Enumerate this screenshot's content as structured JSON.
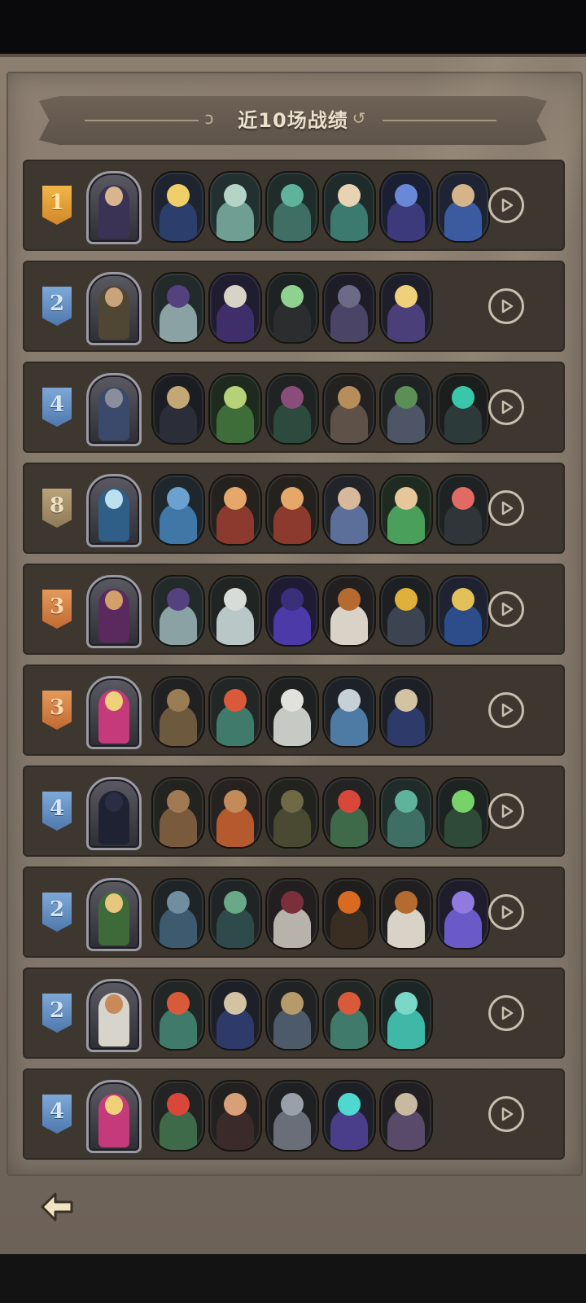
{
  "header": {
    "title": "近10场战绩"
  },
  "matches": [
    {
      "rank": "1",
      "rank_style": "gold",
      "leader": {
        "icon": "leader-portrait-detective",
        "color": "#3b3355",
        "skin": "#d9b58e"
      },
      "heroes": [
        {
          "icon": "hero-portrait-star-boy",
          "bg": "#1e2531",
          "body": "#2c3e6b",
          "face": "#f0cf6a"
        },
        {
          "icon": "hero-portrait-goat",
          "bg": "#223030",
          "body": "#6f9e93",
          "face": "#b6d3c8"
        },
        {
          "icon": "hero-portrait-frog",
          "bg": "#1f2c2a",
          "body": "#3e6e64",
          "face": "#5fb39b"
        },
        {
          "icon": "hero-portrait-bard",
          "bg": "#1f2a2a",
          "body": "#3d7a6e",
          "face": "#e7d2b4"
        },
        {
          "icon": "hero-portrait-sorceress",
          "bg": "#1b1f33",
          "body": "#3c3a7a",
          "face": "#6a88d8"
        },
        {
          "icon": "hero-portrait-king",
          "bg": "#1e2433",
          "body": "#3c5aa0",
          "face": "#d6b48a"
        }
      ]
    },
    {
      "rank": "2",
      "rank_style": "blue",
      "leader": {
        "icon": "leader-portrait-gentleman",
        "color": "#4f4633",
        "skin": "#c8a37c"
      },
      "heroes": [
        {
          "icon": "hero-portrait-tophat",
          "bg": "#232a2a",
          "body": "#8aa2a4",
          "face": "#53427d"
        },
        {
          "icon": "hero-portrait-skeleton",
          "bg": "#211d30",
          "body": "#3e2f6a",
          "face": "#d7d3c6"
        },
        {
          "icon": "hero-portrait-reaper",
          "bg": "#1d2322",
          "body": "#2b2d2f",
          "face": "#8fd18f"
        },
        {
          "icon": "hero-portrait-octopus",
          "bg": "#1e1d27",
          "body": "#4a4466",
          "face": "#6d6a88"
        },
        {
          "icon": "hero-portrait-blonde-girl",
          "bg": "#1e1f2a",
          "body": "#4b3f7a",
          "face": "#f0d07a"
        }
      ]
    },
    {
      "rank": "4",
      "rank_style": "blue",
      "leader": {
        "icon": "leader-portrait-bear",
        "color": "#3b4a6a",
        "skin": "#8b8e9a"
      },
      "heroes": [
        {
          "icon": "hero-portrait-ghoul",
          "bg": "#1b1d22",
          "body": "#2b2e38",
          "face": "#c3a876"
        },
        {
          "icon": "hero-portrait-sprout",
          "bg": "#1f2a1f",
          "body": "#3f6d39",
          "face": "#b5d278"
        },
        {
          "icon": "hero-portrait-witch",
          "bg": "#1f2322",
          "body": "#2d4a3e",
          "face": "#8a4d7a"
        },
        {
          "icon": "hero-portrait-cat",
          "bg": "#232221",
          "body": "#5e5248",
          "face": "#b78d5b"
        },
        {
          "icon": "hero-portrait-goblin-knight",
          "bg": "#1f2324",
          "body": "#4d5566",
          "face": "#5c8f55"
        },
        {
          "icon": "hero-portrait-demon-mask",
          "bg": "#1c1e1e",
          "body": "#2c3a39",
          "face": "#38c7a8"
        }
      ]
    },
    {
      "rank": "8",
      "rank_style": "tan",
      "leader": {
        "icon": "leader-portrait-ice-queen",
        "color": "#2f5e86",
        "skin": "#bde0ef"
      },
      "heroes": [
        {
          "icon": "hero-portrait-blue-dragon",
          "bg": "#1f262c",
          "body": "#3f77a6",
          "face": "#6ba1cf"
        },
        {
          "icon": "hero-portrait-dwarf",
          "bg": "#25221e",
          "body": "#8c3a2e",
          "face": "#e6a86a"
        },
        {
          "icon": "hero-portrait-dwarf-2",
          "bg": "#25221e",
          "body": "#8c3a2e",
          "face": "#e6a86a"
        },
        {
          "icon": "hero-portrait-swordsman",
          "bg": "#22242a",
          "body": "#5b6f9a",
          "face": "#d8b89a"
        },
        {
          "icon": "hero-portrait-fairy",
          "bg": "#1f2b21",
          "body": "#4aa05a",
          "face": "#e5c79a"
        },
        {
          "icon": "hero-portrait-fish-robot",
          "bg": "#1e2222",
          "body": "#2f3538",
          "face": "#e26a64"
        }
      ]
    },
    {
      "rank": "3",
      "rank_style": "orange",
      "leader": {
        "icon": "leader-portrait-wizard",
        "color": "#5a2a5e",
        "skin": "#d4a06a"
      },
      "heroes": [
        {
          "icon": "hero-portrait-tophat",
          "bg": "#232a2a",
          "body": "#8aa2a4",
          "face": "#53427d"
        },
        {
          "icon": "hero-portrait-bird",
          "bg": "#202524",
          "body": "#b9c7c6",
          "face": "#d8dcd6"
        },
        {
          "icon": "hero-portrait-purple-beast",
          "bg": "#1f1b33",
          "body": "#4b3aa8",
          "face": "#3a2f7a"
        },
        {
          "icon": "hero-portrait-pumpkin",
          "bg": "#211f1f",
          "body": "#d8d3c6",
          "face": "#b56a2f"
        },
        {
          "icon": "hero-portrait-tv-robot",
          "bg": "#1d2022",
          "body": "#3c4452",
          "face": "#e0b03c"
        },
        {
          "icon": "hero-portrait-golden-knight",
          "bg": "#1f2331",
          "body": "#2d4d8a",
          "face": "#e2c05a"
        }
      ]
    },
    {
      "rank": "3",
      "rank_style": "orange",
      "leader": {
        "icon": "leader-portrait-blonde-lady",
        "color": "#c43a7a",
        "skin": "#f1d07a"
      },
      "heroes": [
        {
          "icon": "hero-portrait-boar",
          "bg": "#212121",
          "body": "#6d5a3e",
          "face": "#9a7d55"
        },
        {
          "icon": "hero-portrait-redhead",
          "bg": "#222624",
          "body": "#3f7a6a",
          "face": "#d85a3a"
        },
        {
          "icon": "hero-portrait-ghost-old",
          "bg": "#1f2020",
          "body": "#c7c9c4",
          "face": "#e1e2dd"
        },
        {
          "icon": "hero-portrait-owl",
          "bg": "#1d2228",
          "body": "#4d7ba3",
          "face": "#c6d0d6"
        },
        {
          "icon": "hero-portrait-hat-wizard",
          "bg": "#1e2028",
          "body": "#2e3a6a",
          "face": "#d3c3a2"
        }
      ]
    },
    {
      "rank": "4",
      "rank_style": "blue",
      "leader": {
        "icon": "leader-portrait-anubis",
        "color": "#1f2233",
        "skin": "#2b2d44"
      },
      "heroes": [
        {
          "icon": "hero-portrait-treant",
          "bg": "#232320",
          "body": "#7a5a3c",
          "face": "#a07a52"
        },
        {
          "icon": "hero-portrait-autumn-treant",
          "bg": "#262220",
          "body": "#b55a2e",
          "face": "#c48a5a"
        },
        {
          "icon": "hero-portrait-scarecrow",
          "bg": "#22231f",
          "body": "#4a4a33",
          "face": "#6f6a45"
        },
        {
          "icon": "hero-portrait-imp",
          "bg": "#222322",
          "body": "#3e6a4a",
          "face": "#d9463a"
        },
        {
          "icon": "hero-portrait-frog",
          "bg": "#1f2c2a",
          "body": "#3e6e64",
          "face": "#5fb39b"
        },
        {
          "icon": "hero-portrait-plant-monster",
          "bg": "#1d2320",
          "body": "#2f4a36",
          "face": "#78d26a"
        }
      ]
    },
    {
      "rank": "2",
      "rank_style": "blue",
      "leader": {
        "icon": "leader-portrait-elf-lady",
        "color": "#3e6a3a",
        "skin": "#e7c67e"
      },
      "heroes": [
        {
          "icon": "hero-portrait-mushroom-bug",
          "bg": "#1f2426",
          "body": "#3e5a6e",
          "face": "#6f8fa0"
        },
        {
          "icon": "hero-portrait-grin-demon",
          "bg": "#1f2424",
          "body": "#2f4a4a",
          "face": "#6aa88a"
        },
        {
          "icon": "hero-portrait-harlequin",
          "bg": "#231f21",
          "body": "#b7b3aa",
          "face": "#7a2f3a"
        },
        {
          "icon": "hero-portrait-dark-tree",
          "bg": "#1f1e1c",
          "body": "#3a2e22",
          "face": "#d86a22"
        },
        {
          "icon": "hero-portrait-pumpkin",
          "bg": "#211f1f",
          "body": "#d8d3c6",
          "face": "#b56a2f"
        },
        {
          "icon": "hero-portrait-purple-bat",
          "bg": "#1f1d2c",
          "body": "#6a5ac8",
          "face": "#8f7ae0"
        }
      ]
    },
    {
      "rank": "2",
      "rank_style": "blue",
      "leader": {
        "icon": "leader-portrait-bride",
        "color": "#d7d4cc",
        "skin": "#c98a5a"
      },
      "heroes": [
        {
          "icon": "hero-portrait-redhead",
          "bg": "#222624",
          "body": "#3f7a6a",
          "face": "#d85a3a"
        },
        {
          "icon": "hero-portrait-hat-wizard",
          "bg": "#1e2028",
          "body": "#2e3a6a",
          "face": "#d3c3a2"
        },
        {
          "icon": "hero-portrait-gargoyle",
          "bg": "#202224",
          "body": "#4d5a6a",
          "face": "#b79a6a"
        },
        {
          "icon": "hero-portrait-redhead-2",
          "bg": "#222624",
          "body": "#3f7a6a",
          "face": "#d85a3a"
        },
        {
          "icon": "hero-portrait-spirit-warrior",
          "bg": "#1c2624",
          "body": "#3fb8a8",
          "face": "#7ad8c8"
        }
      ]
    },
    {
      "rank": "4",
      "rank_style": "blue",
      "leader": {
        "icon": "leader-portrait-blonde-lady",
        "color": "#c43a7a",
        "skin": "#f1d07a"
      },
      "heroes": [
        {
          "icon": "hero-portrait-imp",
          "bg": "#222322",
          "body": "#3e6a4a",
          "face": "#d9463a"
        },
        {
          "icon": "hero-portrait-little-witch",
          "bg": "#232020",
          "body": "#3a2a2a",
          "face": "#d8a078"
        },
        {
          "icon": "hero-portrait-armored-knight",
          "bg": "#1f2022",
          "body": "#6a6e78",
          "face": "#9aa0aa"
        },
        {
          "icon": "hero-portrait-lightning-mage",
          "bg": "#1d2026",
          "body": "#4a3e8a",
          "face": "#4fd8d0"
        },
        {
          "icon": "hero-portrait-mushroom",
          "bg": "#221f22",
          "body": "#5a4a6a",
          "face": "#c9b9a0"
        }
      ]
    }
  ],
  "footer": {
    "back_icon": "back-arrow-icon"
  },
  "colors": {
    "panel": "#857a6c",
    "row": "#3e3730",
    "title_text": "#ece1cd",
    "replay_icon": "#c9bfae"
  }
}
